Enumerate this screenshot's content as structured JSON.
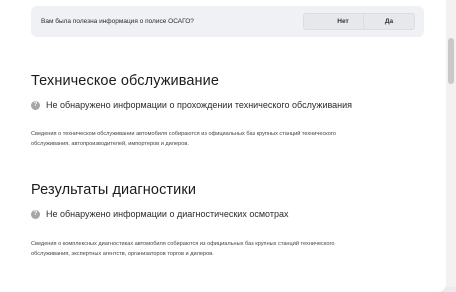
{
  "feedback": {
    "question": "Вам была полезна информация о полисе ОСАГО?",
    "no_label": "Нет",
    "yes_label": "Да"
  },
  "maintenance": {
    "title": "Техническое обслуживание",
    "status": "Не обнаружено информации о прохождении технического обслуживания",
    "description_line1": "Сведения о техническом обслуживании автомобиля собираются из официальных баз крупных станций технического",
    "description_line2": "обслуживания, автопроизводителей, импортеров и дилеров."
  },
  "diagnostics": {
    "title": "Результаты диагностики",
    "status": "Не обнаружено информации о диагностических осмотрах",
    "description_line1": "Сведения о комплексных диагностиках автомобиля собираются из официальных баз крупных станций технического",
    "description_line2": "обслуживания, экспертных агентств, организаторов торгов и дилеров."
  },
  "icons": {
    "status_icon": "question-circle-icon",
    "status_glyph": "?"
  },
  "colors": {
    "feedback_bg": "#f0f1f4",
    "icon_gray": "#a6a6a6"
  }
}
